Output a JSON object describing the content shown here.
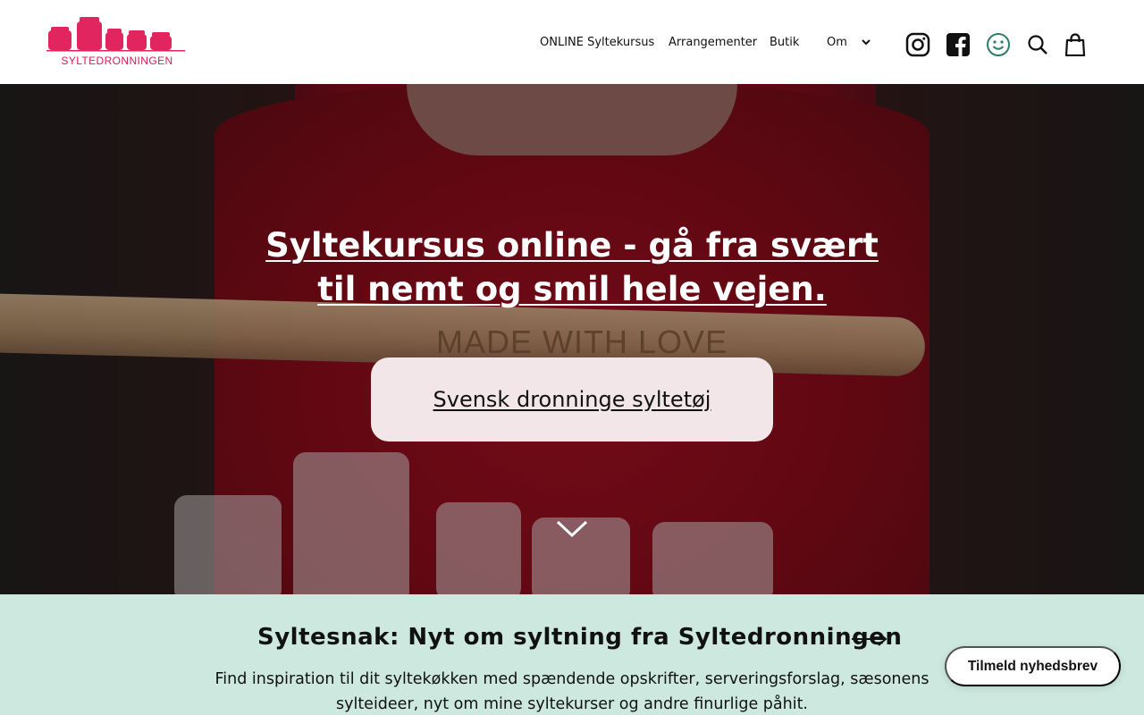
{
  "brand": {
    "name": "SYLTEDRONNINGEN",
    "color": "#e0255f"
  },
  "nav": {
    "items": [
      {
        "label": "ONLINE Syltekursus"
      },
      {
        "label": "Arrangementer"
      },
      {
        "label": "Butik"
      },
      {
        "label": "Om"
      }
    ]
  },
  "header_icons": [
    "instagram-icon",
    "facebook-icon",
    "smiley-icon",
    "search-icon",
    "cart-icon"
  ],
  "hero": {
    "title": "Syltekursus online - gå fra svært til nemt og smil hele vejen.",
    "button_label": "Svensk dronninge syltetøj",
    "spoon_engraving": "MADE WITH LOVE"
  },
  "snak": {
    "title": "Syltesnak: Nyt om syltning fra Syltedronningen",
    "description": "Find inspiration til dit syltekøkken med spændende opskrifter, serveringsforslag, sæsonens sylteideer, nyt om mine syltekurser og andre finurlige påhit."
  },
  "newsletter_button": "Tilmeld nyhedsbrev",
  "colors": {
    "accent_mint": "#cde9df",
    "smiley_green": "#2e7d6b",
    "button_pink": "#f2e6e8"
  }
}
